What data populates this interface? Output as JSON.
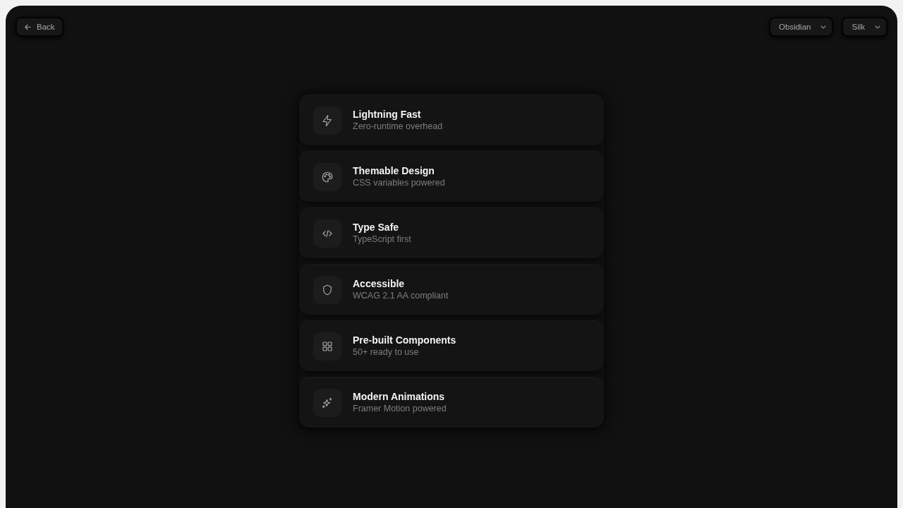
{
  "back_button": {
    "label": "Back"
  },
  "theme_selects": [
    {
      "value": "Obsidian"
    },
    {
      "value": "Silk"
    }
  ],
  "features": [
    {
      "title": "Lightning Fast",
      "subtitle": "Zero-runtime overhead"
    },
    {
      "title": "Themable Design",
      "subtitle": "CSS variables powered"
    },
    {
      "title": "Type Safe",
      "subtitle": "TypeScript first"
    },
    {
      "title": "Accessible",
      "subtitle": "WCAG 2.1 AA compliant"
    },
    {
      "title": "Pre-built Components",
      "subtitle": "50+ ready to use"
    },
    {
      "title": "Modern Animations",
      "subtitle": "Framer Motion powered"
    }
  ]
}
